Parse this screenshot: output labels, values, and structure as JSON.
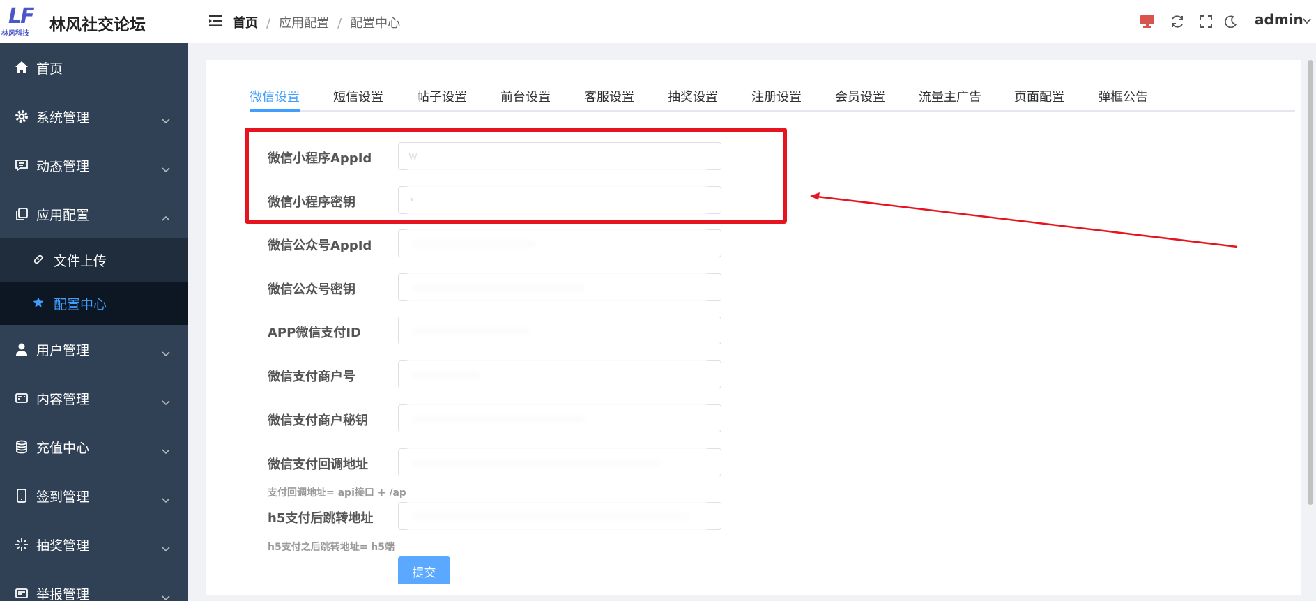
{
  "header": {
    "logo_mark": "LF",
    "logo_sub": "林风科技",
    "site_title": "林风社交论坛",
    "breadcrumb": [
      "首页",
      "应用配置",
      "配置中心"
    ],
    "user": "admin",
    "icons": [
      "monitor-icon",
      "refresh-icon",
      "fullscreen-icon",
      "moon-icon"
    ],
    "monitor_color": "#d9534f"
  },
  "sidebar": {
    "items": [
      {
        "label": "首页",
        "icon": "home-icon"
      },
      {
        "label": "系统管理",
        "icon": "gear-icon"
      },
      {
        "label": "动态管理",
        "icon": "message-icon"
      },
      {
        "label": "应用配置",
        "icon": "copy-icon",
        "expanded": true
      },
      {
        "label": "用户管理",
        "icon": "user-icon"
      },
      {
        "label": "内容管理",
        "icon": "card-icon"
      },
      {
        "label": "充值中心",
        "icon": "coins-icon"
      },
      {
        "label": "签到管理",
        "icon": "tablet-icon"
      },
      {
        "label": "抽奖管理",
        "icon": "sparkle-icon"
      },
      {
        "label": "举报管理",
        "icon": "report-icon"
      }
    ],
    "sub_items": [
      {
        "label": "文件上传",
        "icon": "link-icon"
      },
      {
        "label": "配置中心",
        "icon": "star-icon",
        "active": true
      }
    ]
  },
  "tabs": [
    "微信设置",
    "短信设置",
    "帖子设置",
    "前台设置",
    "客服设置",
    "抽奖设置",
    "注册设置",
    "会员设置",
    "流量主广告",
    "页面配置",
    "弹框公告"
  ],
  "active_tab": "微信设置",
  "form": {
    "rows": [
      {
        "label": "微信小程序AppId",
        "value": "w"
      },
      {
        "label": "微信小程序密钥",
        "value": "•"
      },
      {
        "label": "微信公众号AppId",
        "value": ""
      },
      {
        "label": "微信公众号密钥",
        "value": ""
      },
      {
        "label": "APP微信支付ID",
        "value": ""
      },
      {
        "label": "微信支付商户号",
        "value": ""
      },
      {
        "label": "微信支付商户秘钥",
        "value": ""
      },
      {
        "label": "微信支付回调地址",
        "value": ""
      },
      {
        "label": "h5支付后跳转地址",
        "value": ""
      }
    ],
    "hint_callback": "支付回调地址= api接口 + /ap",
    "hint_h5": "h5支付之后跳转地址= h5端",
    "submit_label": "提交"
  },
  "colors": {
    "accent": "#409eff",
    "sidebar_bg": "#304156",
    "annotation": "#e6141e"
  }
}
